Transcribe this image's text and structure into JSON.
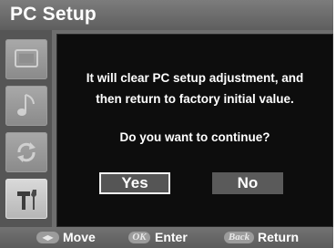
{
  "header": {
    "title": "PC Setup"
  },
  "sidebar": {
    "items": [
      {
        "name": "screen-icon"
      },
      {
        "name": "music-note-icon"
      },
      {
        "name": "recycle-arrows-icon"
      },
      {
        "name": "tools-icon"
      }
    ],
    "active_index": 3
  },
  "dialog": {
    "line1": "It will clear PC setup adjustment, and",
    "line2": "then return to factory initial value.",
    "question": "Do you want to continue?",
    "yes_label": "Yes",
    "no_label": "No",
    "selected": "Yes"
  },
  "footer": {
    "move_icon_text": "◀▶",
    "move_label": "Move",
    "enter_icon_text": "OK",
    "enter_label": "Enter",
    "return_icon_text": "Back",
    "return_label": "Return"
  },
  "colors": {
    "frame": "#6e6e6e",
    "dialog_bg": "#0d0d0d",
    "button_bg": "#5a5a5a",
    "text": "#ffffff"
  }
}
